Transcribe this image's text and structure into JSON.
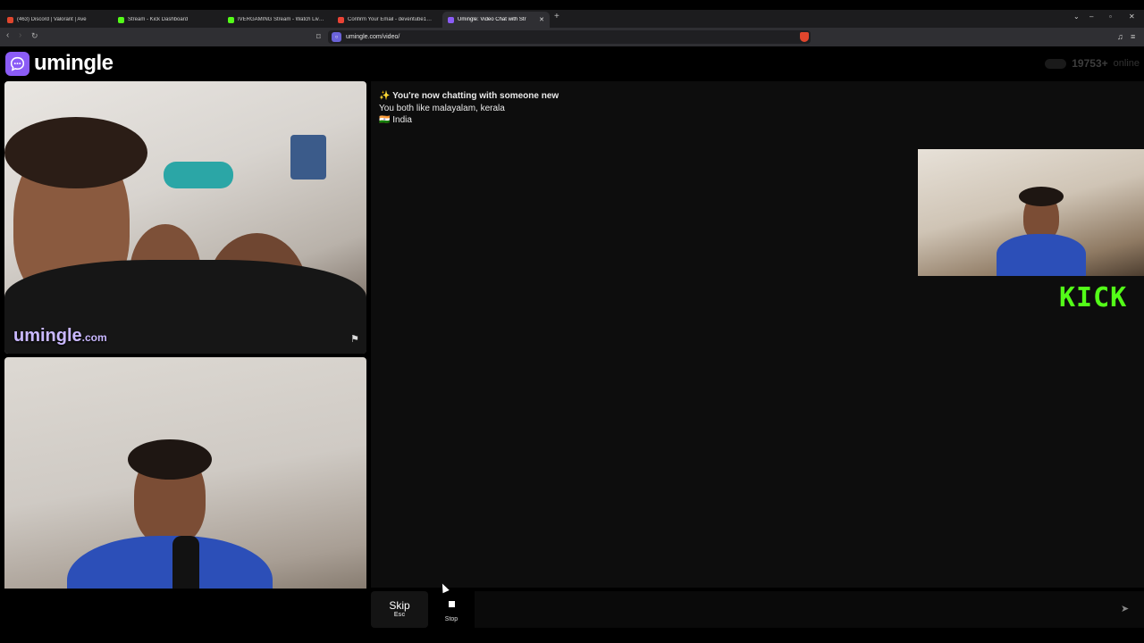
{
  "browser": {
    "tabs": [
      {
        "label": "(463) Discord | Valorant | Ave",
        "favicon_color": "#e0462d",
        "active": false
      },
      {
        "label": "Stream - Kick Dashboard",
        "favicon_color": "#53fc18",
        "active": false
      },
      {
        "label": "IVERGAMING Stream - Watch Live on",
        "favicon_color": "#53fc18",
        "active": false
      },
      {
        "label": "Confirm Your Email - deventube123@",
        "favicon_color": "#ea4335",
        "active": false
      },
      {
        "label": "Umingle: Video Chat with Str",
        "favicon_color": "#8b5cf6",
        "active": true
      }
    ],
    "new_tab": "+",
    "url": "umingle.com/video/"
  },
  "site": {
    "logo_text": "umingle",
    "online_count": "19753+",
    "online_label": "online",
    "brand_color": "#8b5cf6"
  },
  "remote_video": {
    "watermark": "umingle",
    "watermark_suffix": ".com"
  },
  "chat": {
    "messages": [
      {
        "icon": "✨",
        "text": "You're now chatting with someone new"
      },
      {
        "text": "You both like malayalam, kerala"
      },
      {
        "icon": "🇮🇳",
        "text": "India"
      }
    ]
  },
  "overlay": {
    "kick_logo": "KICK",
    "kick_color": "#53fc18"
  },
  "controls": {
    "skip_label": "Skip",
    "skip_key": "Esc",
    "stop_label": "Stop",
    "message_placeholder": ""
  }
}
